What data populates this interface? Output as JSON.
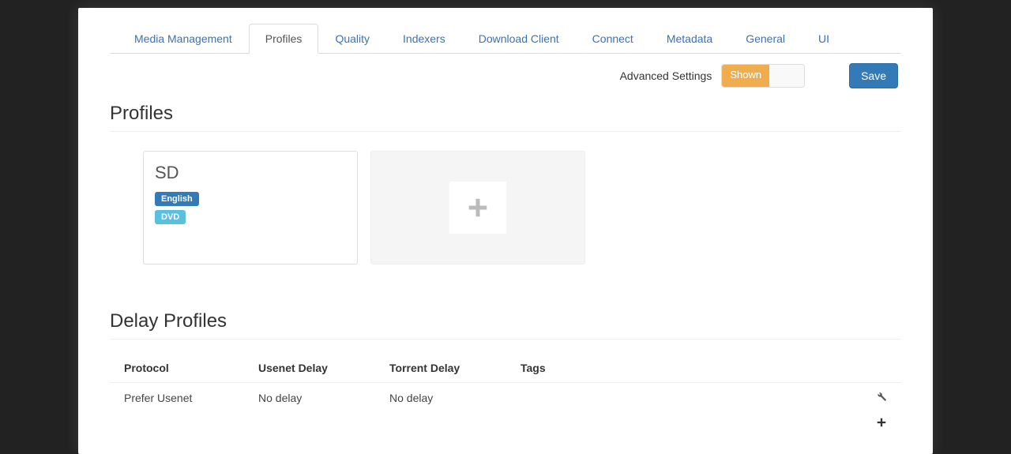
{
  "tabs": {
    "media_management": "Media Management",
    "profiles": "Profiles",
    "quality": "Quality",
    "indexers": "Indexers",
    "download_client": "Download Client",
    "connect": "Connect",
    "metadata": "Metadata",
    "general": "General",
    "ui": "UI"
  },
  "toolbar": {
    "advanced_label": "Advanced Settings",
    "toggle_state": "Shown",
    "save_label": "Save"
  },
  "sections": {
    "profiles_title": "Profiles",
    "delay_title": "Delay Profiles"
  },
  "profile_card": {
    "name": "SD",
    "language_badge": "English",
    "cutoff_badge": "DVD"
  },
  "delay_table": {
    "headers": {
      "protocol": "Protocol",
      "usenet": "Usenet Delay",
      "torrent": "Torrent Delay",
      "tags": "Tags"
    },
    "row": {
      "protocol": "Prefer Usenet",
      "usenet": "No delay",
      "torrent": "No delay",
      "tags": ""
    }
  }
}
